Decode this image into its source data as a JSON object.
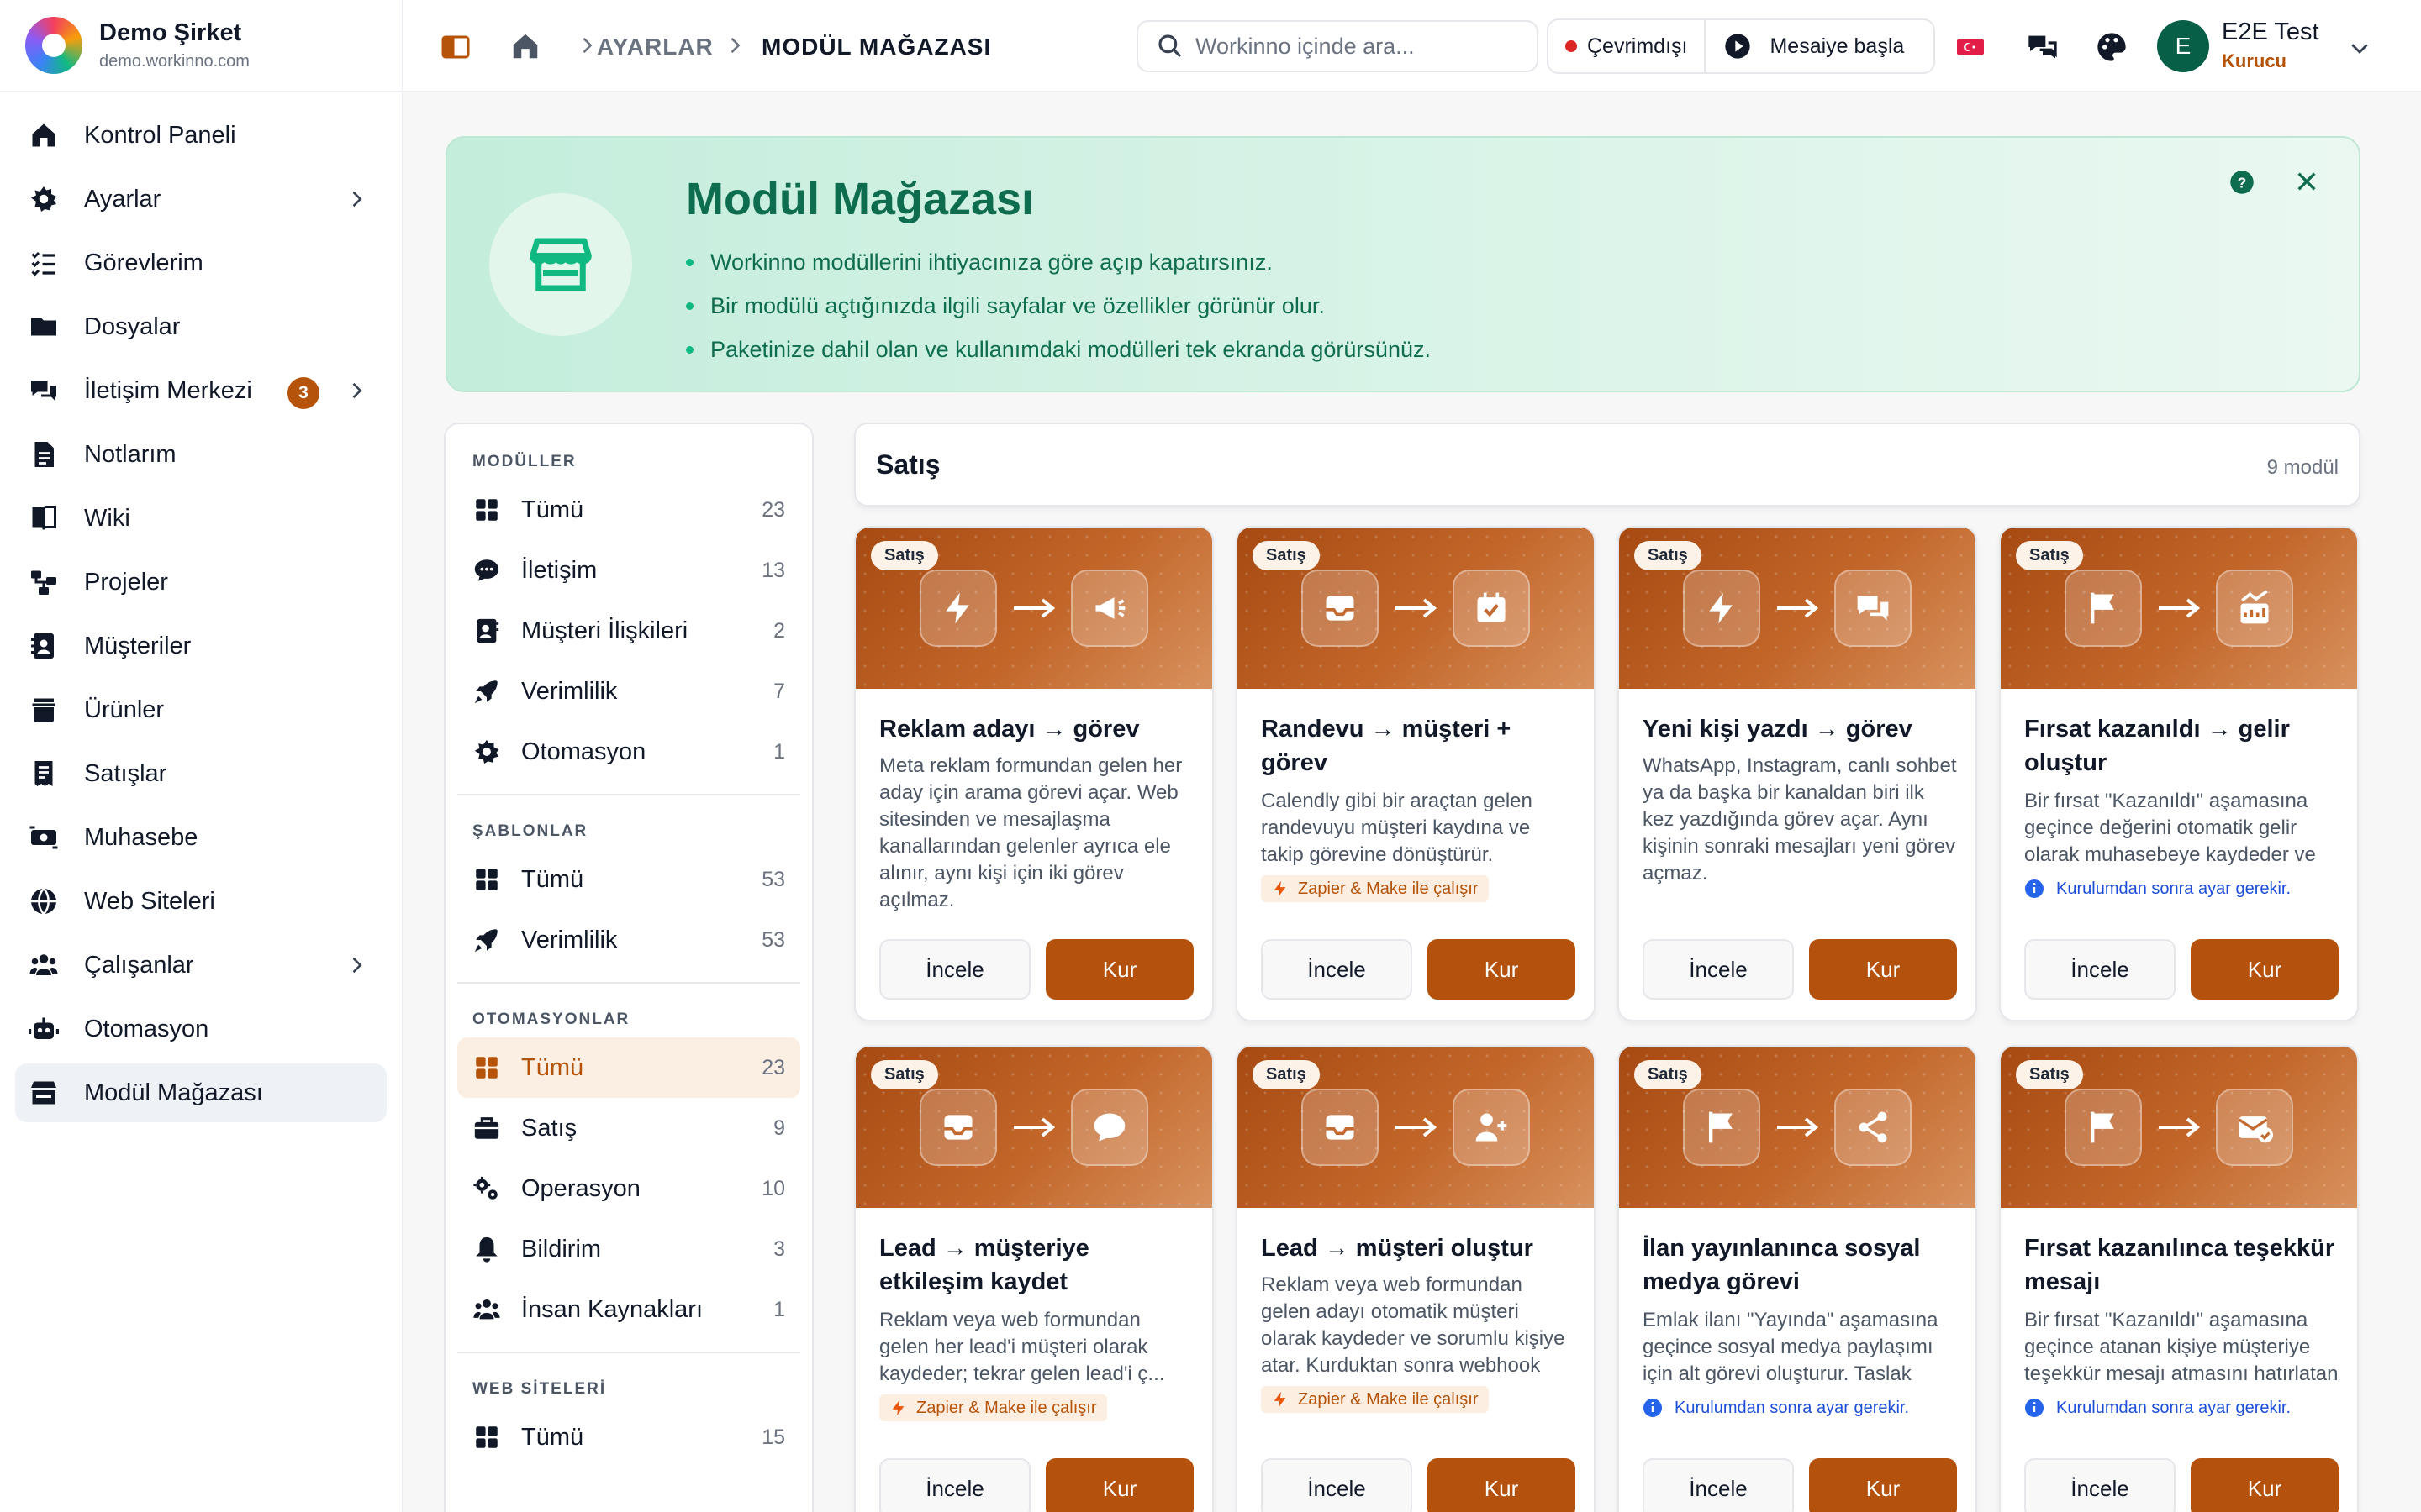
{
  "brand": {
    "name": "Demo Şirket",
    "domain": "demo.workinno.com"
  },
  "sidebar": {
    "items": [
      {
        "label": "Kontrol Paneli",
        "icon": "home-icon"
      },
      {
        "label": "Ayarlar",
        "icon": "gear-icon",
        "chevron": true
      },
      {
        "label": "Görevlerim",
        "icon": "list-check-icon"
      },
      {
        "label": "Dosyalar",
        "icon": "folder-icon"
      },
      {
        "label": "İletişim Merkezi",
        "icon": "chat-icon",
        "badge": "3",
        "chevron": true
      },
      {
        "label": "Notlarım",
        "icon": "note-icon"
      },
      {
        "label": "Wiki",
        "icon": "book-icon"
      },
      {
        "label": "Projeler",
        "icon": "project-icon"
      },
      {
        "label": "Müşteriler",
        "icon": "contact-icon"
      },
      {
        "label": "Ürünler",
        "icon": "box-icon"
      },
      {
        "label": "Satışlar",
        "icon": "receipt-icon"
      },
      {
        "label": "Muhasebe",
        "icon": "money-icon"
      },
      {
        "label": "Web Siteleri",
        "icon": "globe-icon"
      },
      {
        "label": "Çalışanlar",
        "icon": "users-icon",
        "chevron": true
      },
      {
        "label": "Otomasyon",
        "icon": "robot-icon"
      },
      {
        "label": "Modül Mağazası",
        "icon": "store-icon",
        "active": true
      }
    ]
  },
  "header": {
    "breadcrumb": [
      "AYARLAR",
      "MODÜL MAĞAZASI"
    ],
    "search_placeholder": "Workinno içinde ara...",
    "status": "Çevrimdışı",
    "shift_button": "Mesaiye başla",
    "user": {
      "initial": "E",
      "name": "E2E Test",
      "role": "Kurucu"
    }
  },
  "banner": {
    "title": "Modül Mağazası",
    "bullets": [
      "Workinno modüllerini ihtiyacınıza göre açıp kapatırsınız.",
      "Bir modülü açtığınızda ilgili sayfalar ve özellikler görünür olur.",
      "Paketinize dahil olan ve kullanımdaki modülleri tek ekranda görürsünüz."
    ]
  },
  "filters": {
    "modules": {
      "heading": "MODÜLLER",
      "items": [
        {
          "label": "Tümü",
          "count": "23",
          "icon": "grid-icon"
        },
        {
          "label": "İletişim",
          "count": "13",
          "icon": "chat-bubble-icon"
        },
        {
          "label": "Müşteri İlişkileri",
          "count": "2",
          "icon": "contact-card-icon"
        },
        {
          "label": "Verimlilik",
          "count": "7",
          "icon": "rocket-icon"
        },
        {
          "label": "Otomasyon",
          "count": "1",
          "icon": "gear-icon"
        }
      ]
    },
    "templates": {
      "heading": "ŞABLONLAR",
      "items": [
        {
          "label": "Tümü",
          "count": "53",
          "icon": "grid-icon"
        },
        {
          "label": "Verimlilik",
          "count": "53",
          "icon": "rocket-icon"
        }
      ]
    },
    "automations": {
      "heading": "OTOMASYONLAR",
      "items": [
        {
          "label": "Tümü",
          "count": "23",
          "icon": "grid-icon",
          "active": true
        },
        {
          "label": "Satış",
          "count": "9",
          "icon": "briefcase-icon"
        },
        {
          "label": "Operasyon",
          "count": "10",
          "icon": "gears-icon"
        },
        {
          "label": "Bildirim",
          "count": "3",
          "icon": "bell-icon"
        },
        {
          "label": "İnsan Kaynakları",
          "count": "1",
          "icon": "users-icon"
        }
      ]
    },
    "websites": {
      "heading": "WEB SİTELERİ",
      "items": [
        {
          "label": "Tümü",
          "count": "15",
          "icon": "grid-icon"
        }
      ]
    }
  },
  "section": {
    "title": "Satış",
    "count": "9 modül"
  },
  "cards": [
    {
      "chip": "Satış",
      "from": "bolt-icon",
      "to": "megaphone-icon",
      "title": "Reklam adayı → görev",
      "desc": "Meta reklam formundan gelen her aday için arama görevi açar. Web sitesinden ve mesajlaşma kanallarından gelenler ayrıca ele alınır, aynı kişi için iki görev açılmaz.",
      "tag": ""
    },
    {
      "chip": "Satış",
      "from": "inbox-icon",
      "to": "calendar-check-icon",
      "title": "Randevu → müşteri + görev",
      "desc": "Calendly gibi bir araçtan gelen randevuyu müşteri kaydına ve takip görevine dönüştürür. Randevu sahibi bilgileri otomatik olarak aktarılır.",
      "tag": "zap",
      "tag_text": "Zapier & Make ile çalışır"
    },
    {
      "chip": "Satış",
      "from": "bolt-icon",
      "to": "chat-icon",
      "title": "Yeni kişi yazdı → görev",
      "desc": "WhatsApp, Instagram, canlı sohbet ya da başka bir kanaldan biri ilk kez yazdığında görev açar. Aynı kişinin sonraki mesajları yeni görev açmaz.",
      "tag": ""
    },
    {
      "chip": "Satış",
      "from": "flag-icon",
      "to": "chart-icon",
      "title": "Fırsat kazanıldı → gelir oluştur",
      "desc": "Bir fırsat \"Kazanıldı\" aşamasına geçince değerini otomatik gelir olarak muhasebeye kaydeder ve ilgili raporları günceller.",
      "tag": "info",
      "tag_text": "Kurulumdan sonra ayar gerekir."
    },
    {
      "chip": "Satış",
      "from": "inbox-icon",
      "to": "chat-bubble-icon",
      "title": "Lead → müşteriye etkileşim kaydet",
      "desc": "Reklam veya web formundan gelen her lead'i müşteri olarak kaydeder; tekrar gelen lead'i ç...",
      "tag": "zap",
      "tag_text": "Zapier & Make ile çalışır"
    },
    {
      "chip": "Satış",
      "from": "inbox-icon",
      "to": "user-plus-icon",
      "title": "Lead → müşteri oluştur",
      "desc": "Reklam veya web formundan gelen adayı otomatik müşteri olarak kaydeder ve sorumlu kişiye atar. Kurduktan sonra webhook adresini Zapier veya Make'e ekleyin.",
      "tag": "zap",
      "tag_text": "Zapier & Make ile çalışır"
    },
    {
      "chip": "Satış",
      "from": "flag-icon",
      "to": "share-icon",
      "title": "İlan yayınlanınca sosyal medya görevi",
      "desc": "Emlak ilanı \"Yayında\" aşamasına geçince sosyal medya paylaşımı için alt görevi oluşturur. Taslak metin otomatik olarak hazırlanır.",
      "tag": "info",
      "tag_text": "Kurulumdan sonra ayar gerekir."
    },
    {
      "chip": "Satış",
      "from": "flag-icon",
      "to": "mail-check-icon",
      "title": "Fırsat kazanılınca teşekkür mesajı",
      "desc": "Bir fırsat \"Kazanıldı\" aşamasına geçince atanan kişiye müşteriye teşekkür mesajı atmasını hatırlatan bir görev açar.",
      "tag": "info",
      "tag_text": "Kurulumdan sonra ayar gerekir."
    }
  ],
  "card_buttons": {
    "view": "İncele",
    "install": "Kur"
  },
  "colors": {
    "accent": "#b4510d",
    "brand_green": "#0f6d4f",
    "badge": "#b45309"
  }
}
